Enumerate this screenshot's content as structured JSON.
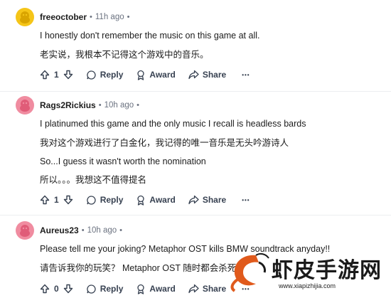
{
  "comments": [
    {
      "user": "freeoctober",
      "time": "11h ago",
      "lines": [
        "I honestly don't remember the music on this game at all.",
        "老实说，我根本不记得这个游戏中的音乐。"
      ],
      "votes": "1",
      "reply": "Reply",
      "award": "Award",
      "share": "Share",
      "more": "•••",
      "avatar_color": "#f5c518"
    },
    {
      "user": "Rags2Rickius",
      "time": "10h ago",
      "lines": [
        "I platinumed this game and the only music I recall is headless bards",
        "我对这个游戏进行了白金化，我记得的唯一音乐是无头吟游诗人",
        "So...I guess it wasn't worth the nomination",
        "所以。。。我想这不值得提名"
      ],
      "votes": "1",
      "reply": "Reply",
      "award": "Award",
      "share": "Share",
      "more": "•••",
      "avatar_color": "#f08ca0"
    },
    {
      "user": "Aureus23",
      "time": "10h ago",
      "lines": [
        "Please tell me your joking? Metaphor OST kills BMW soundtrack anyday!!",
        "请告诉我你的玩笑？ Metaphor OST 随时都会杀死"
      ],
      "votes": "0",
      "reply": "Reply",
      "award": "Award",
      "share": "Share",
      "more": "•••",
      "avatar_color": "#f08ca0"
    }
  ],
  "separator": "•",
  "watermark": {
    "text": "虾皮手游网",
    "url": "www.xiapizhijia.com"
  },
  "icons": [
    "upvote-icon",
    "downvote-icon",
    "reply-icon",
    "award-icon",
    "share-icon",
    "more-icon"
  ]
}
